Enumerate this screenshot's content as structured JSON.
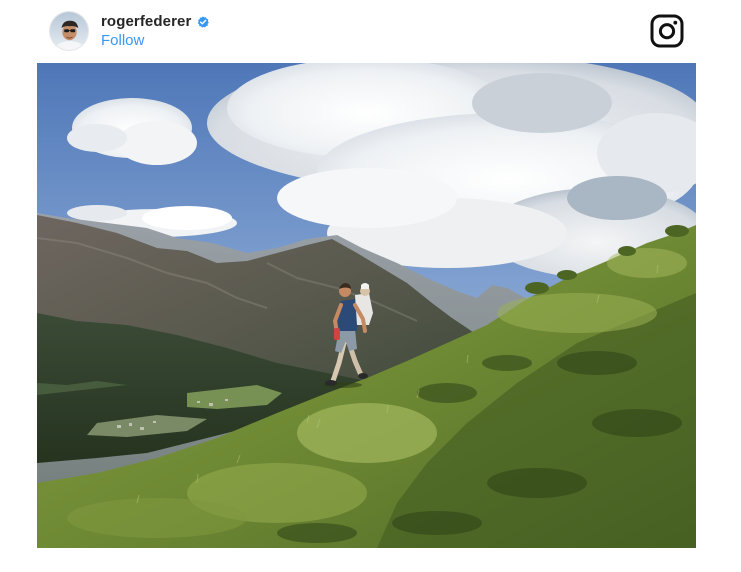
{
  "post": {
    "username": "roger​federer",
    "follow_label": "Follow",
    "verified_color": "#3897f0",
    "follow_color": "#3897f0"
  },
  "icons": {
    "verified": "verified-badge-icon",
    "brand": "instagram-icon"
  },
  "colors": {
    "username": "#262626",
    "background": "#ffffff"
  }
}
